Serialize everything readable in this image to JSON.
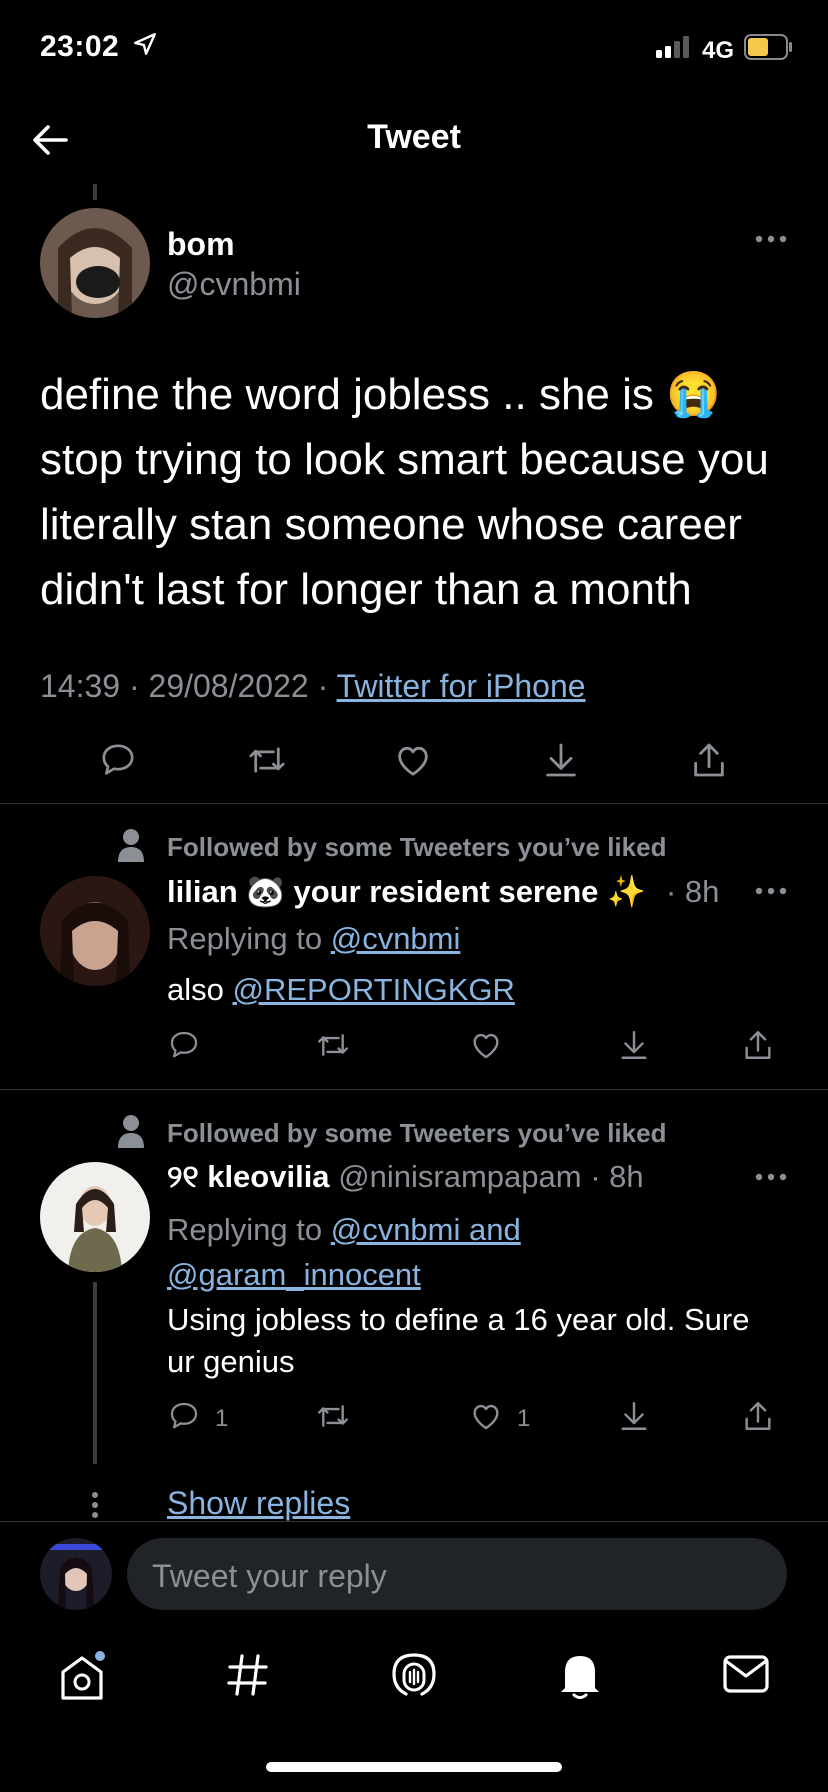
{
  "status_bar": {
    "time": "23:02",
    "network": "4G"
  },
  "header": {
    "title": "Tweet"
  },
  "main_tweet": {
    "name": "bom",
    "handle": "@cvnbmi",
    "text_lines": [
      "define the word jobless .. she is 😭",
      "stop trying to look smart because you",
      "literally stan someone whose career",
      "didn't last for longer than a month"
    ],
    "time": "14:39",
    "date": "29/08/2022",
    "source": "Twitter for iPhone",
    "sep": "·"
  },
  "replies": [
    {
      "social_context": "Followed by some Tweeters you’ve liked",
      "name": "lilian 🐼 your resident serene ✨",
      "meta": "· 8h",
      "replying_prefix": "Replying to",
      "replying_to": "@cvnbmi",
      "text_prefix": "also",
      "text_mention": "@REPORTINGKGR"
    },
    {
      "social_context": "Followed by some Tweeters you’ve liked",
      "name": "୨୧ kleovilia",
      "handle": "@ninisrampapam",
      "meta": "· 8h",
      "replying_prefix": "Replying to",
      "replying_to_line1": "@cvnbmi and",
      "replying_to_line2": "@garam_innocent",
      "text_lines": [
        "Using jobless to define a 16 year old. Sure",
        "ur genius"
      ],
      "reply_count": "1",
      "like_count": "1"
    }
  ],
  "show_replies": "Show replies",
  "composer": {
    "placeholder": "Tweet your reply"
  },
  "colors": {
    "background": "#000000",
    "link": "#8ab4e0",
    "muted": "#8b9096",
    "divider": "#2f3336"
  }
}
